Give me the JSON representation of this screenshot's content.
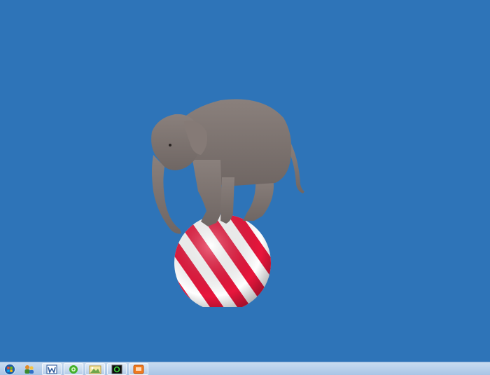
{
  "desktop": {
    "background_color": "#2e74b8",
    "wallpaper": {
      "subject": "elephant-on-ball",
      "ball_stripe_color": "#e8163c",
      "ball_base_color": "#ffffff",
      "elephant_color": "#7d7370"
    }
  },
  "taskbar": {
    "background_color": "#b9d1ec",
    "items": [
      {
        "icon": "start-orb-icon",
        "pinned": false
      },
      {
        "icon": "user-accounts-icon",
        "pinned": false
      },
      {
        "icon": "word-processor-icon",
        "pinned": true
      },
      {
        "icon": "messenger-icon",
        "pinned": true
      },
      {
        "icon": "image-viewer-icon",
        "pinned": true
      },
      {
        "icon": "terminal-icon",
        "pinned": true
      },
      {
        "icon": "presentation-icon",
        "pinned": true
      }
    ]
  }
}
